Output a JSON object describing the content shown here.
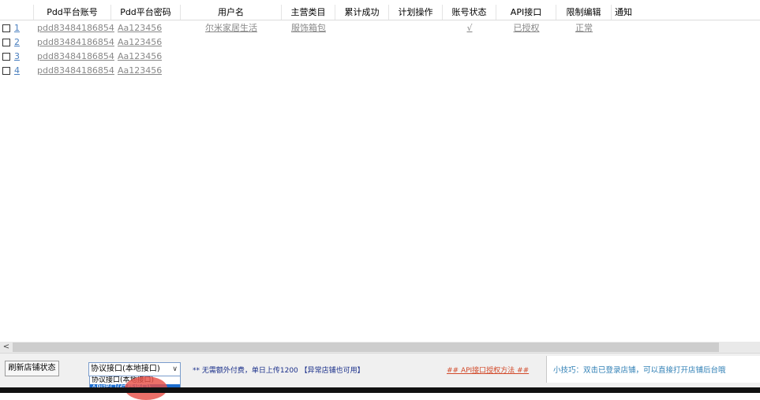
{
  "table": {
    "columns": [
      "Pdd平台账号",
      "Pdd平台密码",
      "用户名",
      "主营类目",
      "累计成功",
      "计划操作",
      "账号状态",
      "API接口",
      "限制编辑",
      "通知"
    ],
    "rows": [
      {
        "num": "1",
        "account": "pdd83484186854",
        "password": "Aa123456",
        "username": "尔米家居生活",
        "category": "服饰箱包",
        "success": "",
        "plan": "",
        "status": "√",
        "api": "已授权",
        "restrict": "正常",
        "notice": ""
      },
      {
        "num": "2",
        "account": "pdd83484186854",
        "password": "Aa123456"
      },
      {
        "num": "3",
        "account": "pdd83484186854",
        "password": "Aa123456"
      },
      {
        "num": "4",
        "account": "pdd83484186854",
        "password": "Aa123456"
      }
    ]
  },
  "scrollbar": {
    "left_arrow": "<"
  },
  "bottom": {
    "refresh_label": "刷新店铺状态",
    "select_value": "协议接口(本地接口)",
    "select_arrow": "∨",
    "options": [
      "协议接口(本地接口)",
      "API接口(付费接口)"
    ],
    "note": "** 无需额外付费，单日上传1200 【异常店铺也可用】",
    "api_auth_link": "## API接口授权方法 ##",
    "tip": "小技巧：双击已登录店铺，可以直接打开店铺后台哦"
  }
}
